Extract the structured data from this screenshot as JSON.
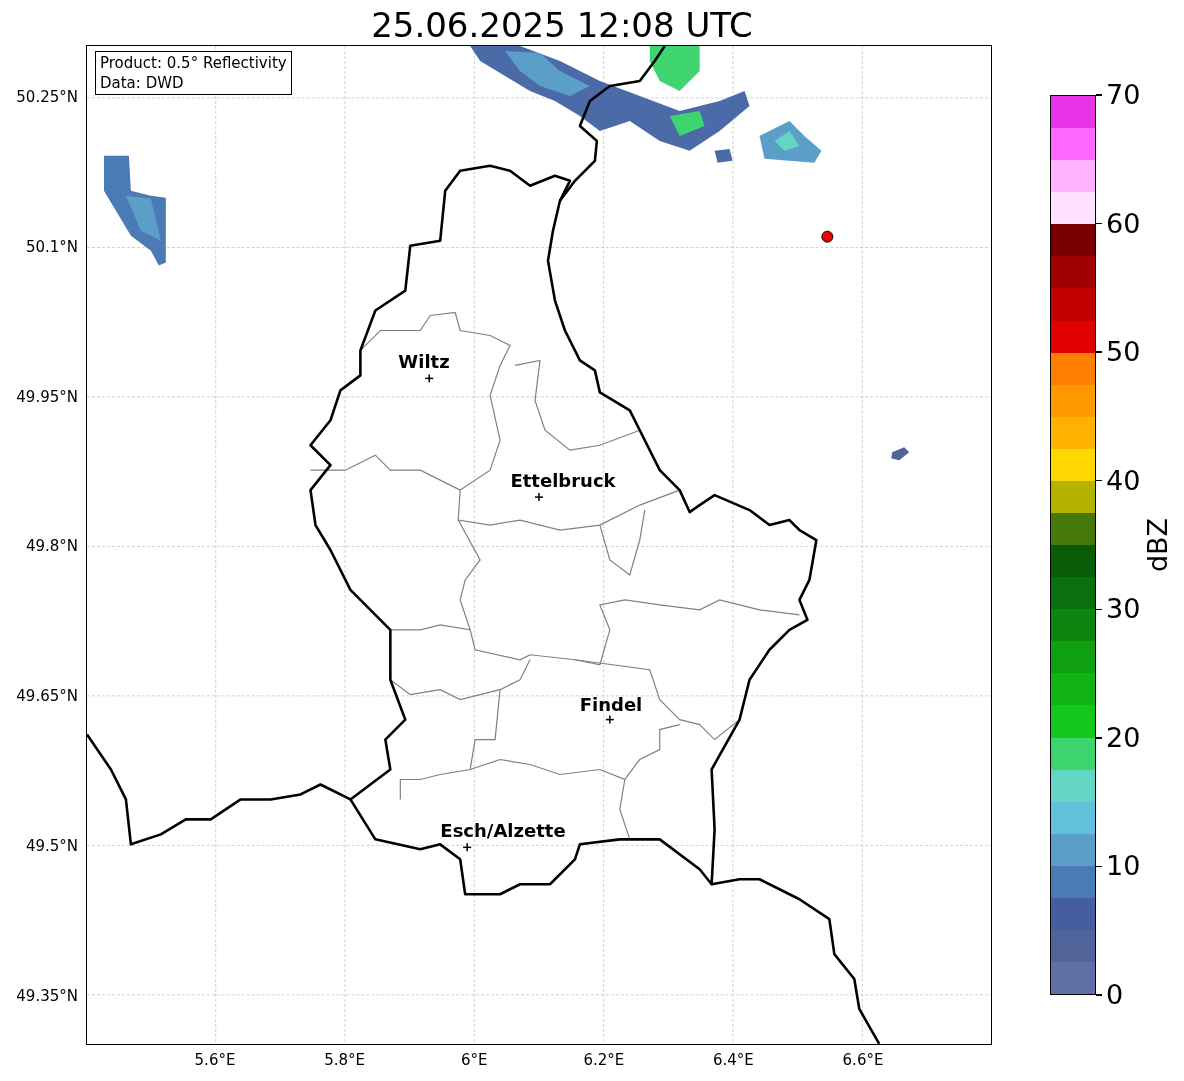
{
  "title": "25.06.2025 12:08 UTC",
  "info_box": {
    "lines": [
      "Product: 0.5° Reflectivity",
      "Data: DWD"
    ]
  },
  "map": {
    "cities": [
      {
        "name": "Wiltz"
      },
      {
        "name": "Ettelbruck"
      },
      {
        "name": "Findel"
      },
      {
        "name": "Esch/Alzette"
      }
    ],
    "lat_ticks": [
      "50.25°N",
      "50.1°N",
      "49.95°N",
      "49.8°N",
      "49.65°N",
      "49.5°N",
      "49.35°N"
    ],
    "lon_ticks": [
      "5.6°E",
      "5.8°E",
      "6°E",
      "6.2°E",
      "6.4°E",
      "6.6°E"
    ]
  },
  "colorbar": {
    "label": "dBZ",
    "ticks": [
      "70",
      "60",
      "50",
      "40",
      "30",
      "20",
      "10",
      "0"
    ],
    "bins": [
      {
        "color": "#e832e8"
      },
      {
        "color": "#ff66ff"
      },
      {
        "color": "#ffb3ff"
      },
      {
        "color": "#ffe0ff"
      },
      {
        "color": "#7a0000"
      },
      {
        "color": "#a00000"
      },
      {
        "color": "#c20000"
      },
      {
        "color": "#e00000"
      },
      {
        "color": "#ff7f00"
      },
      {
        "color": "#ff9900"
      },
      {
        "color": "#ffb300"
      },
      {
        "color": "#ffd700"
      },
      {
        "color": "#b3b300"
      },
      {
        "color": "#457a0a"
      },
      {
        "color": "#085c08"
      },
      {
        "color": "#0a700f"
      },
      {
        "color": "#0c860f"
      },
      {
        "color": "#0ea010"
      },
      {
        "color": "#10b414"
      },
      {
        "color": "#12c81a"
      },
      {
        "color": "#3ed46e"
      },
      {
        "color": "#62d6c2"
      },
      {
        "color": "#62c0dc"
      },
      {
        "color": "#5b9fc8"
      },
      {
        "color": "#4a7bb4"
      },
      {
        "color": "#445ea0"
      },
      {
        "color": "#51649a"
      },
      {
        "color": "#6070a6"
      }
    ]
  }
}
